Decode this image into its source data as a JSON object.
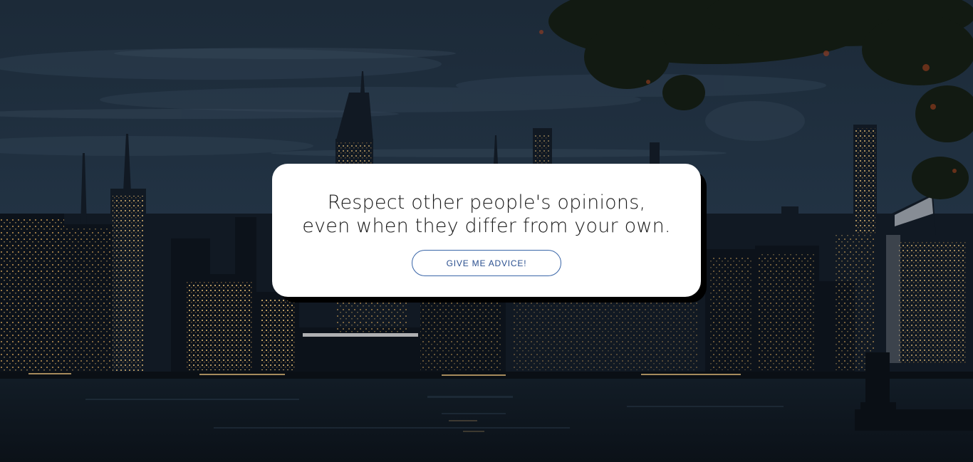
{
  "advice": {
    "quote": "Respect other people's opinions, even when they differ from your own.",
    "button_label": "GIVE ME ADVICE!"
  },
  "background": {
    "description_icon": "city-skyline-night-image"
  },
  "colors": {
    "card": "#ffffff",
    "card_shadow": "#000000",
    "button_border": "#3a66a8",
    "button_text": "#2a4f8f"
  }
}
